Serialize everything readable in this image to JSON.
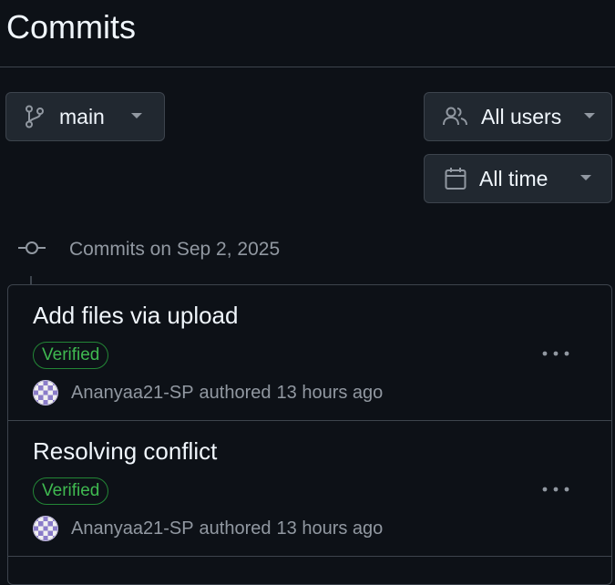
{
  "page": {
    "title": "Commits"
  },
  "filters": {
    "branch": {
      "label": "main",
      "icon": "git-branch-icon"
    },
    "users": {
      "label": "All users",
      "icon": "people-icon"
    },
    "time": {
      "label": "All time",
      "icon": "calendar-icon"
    }
  },
  "group": {
    "heading": "Commits on Sep 2, 2025",
    "icon": "git-commit-icon"
  },
  "commits": [
    {
      "message": "Add files via upload",
      "badge": "Verified",
      "author": "Ananyaa21-SP",
      "action": "authored",
      "time": "13 hours ago"
    },
    {
      "message": "Resolving conflict",
      "badge": "Verified",
      "author": "Ananyaa21-SP",
      "action": "authored",
      "time": "13 hours ago"
    }
  ],
  "colors": {
    "background": "#0d1117",
    "border": "#3d444d",
    "verified": "#3fb950",
    "muted": "#9198a1"
  }
}
